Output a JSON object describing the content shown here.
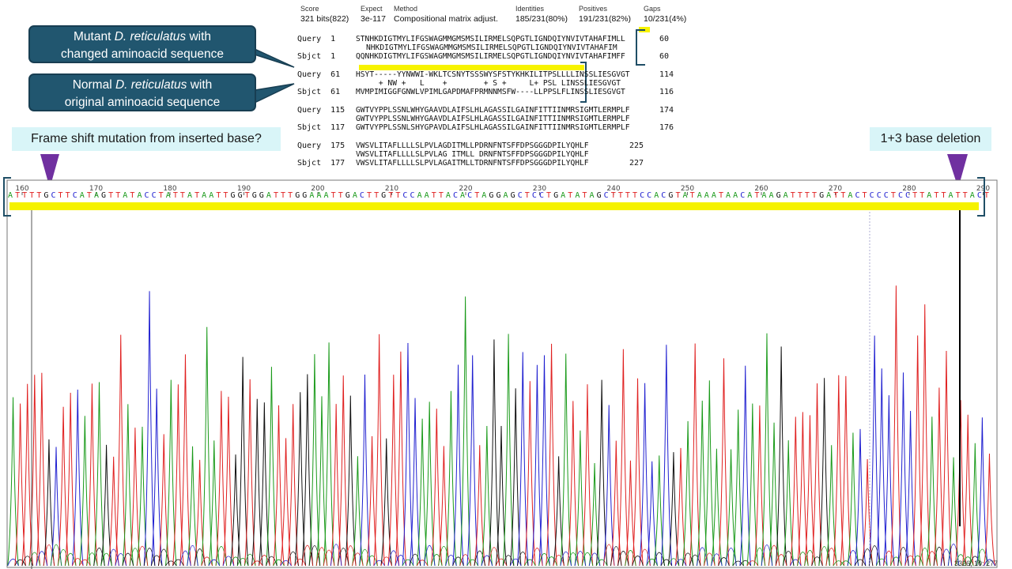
{
  "blast": {
    "header": {
      "labels": [
        "Score",
        "Expect",
        "Method",
        "Identities",
        "Positives",
        "Gaps"
      ],
      "values": [
        "321 bits(822)",
        "3e-117",
        "Compositional matrix adjust.",
        "185/231(80%)",
        "191/231(82%)",
        "10/231(4%)"
      ]
    },
    "blocks": [
      {
        "q_label": "Query  1",
        "q_seq": "STNHKDIGTMYLIFGSWAGMMGMSMSILIRMELSQPGTLIGNDQIYNVIVTAHAFIMLL",
        "q_end": "60",
        "mid": "NHKDIGTMYLIFGSWAGMMGMSMSILIRMELSQPGTLIGNDQIYNVIVTAHAFIM",
        "s_label": "Sbjct  1",
        "s_seq": "QQNHKDIGTMYLIFGSWAGMMGMSMSILIRMELSQPGTLIGNDQIYNVIVTAHAFIMFF",
        "s_end": "60"
      },
      {
        "q_label": "Query  61",
        "q_seq": "HSYT-----YYNWWI-WKLTCSNYTSSSWYSFSTYKHKILITPSLLLLINSSLIESGVGT",
        "q_end": "114",
        "mid": "     + NW +   L    +        + S +     L+ PSL LINSSLIESGVGT",
        "s_label": "Sbjct  61",
        "s_seq": "MVMPIMIGGFGNWLVPIMLGAPDMAFPRMNNMSFW----LLPPSLFLINSSLIESGVGT",
        "s_end": "116"
      },
      {
        "q_label": "Query  115",
        "q_seq": "GWTVYPPLSSNLWHYGAAVDLAIFSLHLAGASSILGAINFITTIINMRSIGMTLERMPLF",
        "q_end": "174",
        "mid": "GWTVYPPLSSNLWHYGAAVDLAIFSLHLAGASSILGAINFITTIINMRSIGMTLERMPLF",
        "s_label": "Sbjct  117",
        "s_seq": "GWTVYPPLSSNLSHYGPAVDLAIFSLHLAGASSILGAINFITTIINMRSIGMTLERMPLF",
        "s_end": "176"
      },
      {
        "q_label": "Query  175",
        "q_seq": "VWSVLITAFLLLLSLPVLAGDITMLLPDRNFNTSFFDPSGGGDPILYQHLF",
        "q_end": "225",
        "mid": "VWSVLITAFLLLLSLPVLAG ITMLL DRNFNTSFFDPSGGGDPILYQHLF",
        "s_label": "Sbjct  177",
        "s_seq": "VWSVLITAFLLLLSLPVLAGAITMLLTDRNFNTSFFDPSGGGDPILYQHLF",
        "s_end": "227"
      }
    ]
  },
  "callouts": {
    "mutant": {
      "pre": "Mutant ",
      "italic": "D. reticulatus",
      "post": " with",
      "line2": "changed aminoacid sequence"
    },
    "normal": {
      "pre": "Normal ",
      "italic": "D. reticulatus",
      "post": " with",
      "line2": "original aminoacid sequence"
    }
  },
  "tags": {
    "frameshift": "Frame shift mutation from inserted base?",
    "deletion": "1+3 base deletion"
  },
  "chromatogram": {
    "sequence": "ATTTTGCTTCATAGTTATACCTATTATAATTGGTGGATTTGGAAATTGACTTGTTCCAATTACACTAGGAGCTCCTGATATAGCTTTTCCACGTATAAATAACATAAGATTTTGATTACTCCCTCCTTATTATTACT",
    "ticks": [
      "160",
      "170",
      "180",
      "190",
      "200",
      "210",
      "220",
      "230",
      "240",
      "250",
      "260",
      "270",
      "280",
      "290"
    ],
    "status": "3326, 10: 277",
    "colors": {
      "A": "#1a9a1a",
      "C": "#2020d0",
      "G": "#111111",
      "T": "#e02020"
    }
  }
}
